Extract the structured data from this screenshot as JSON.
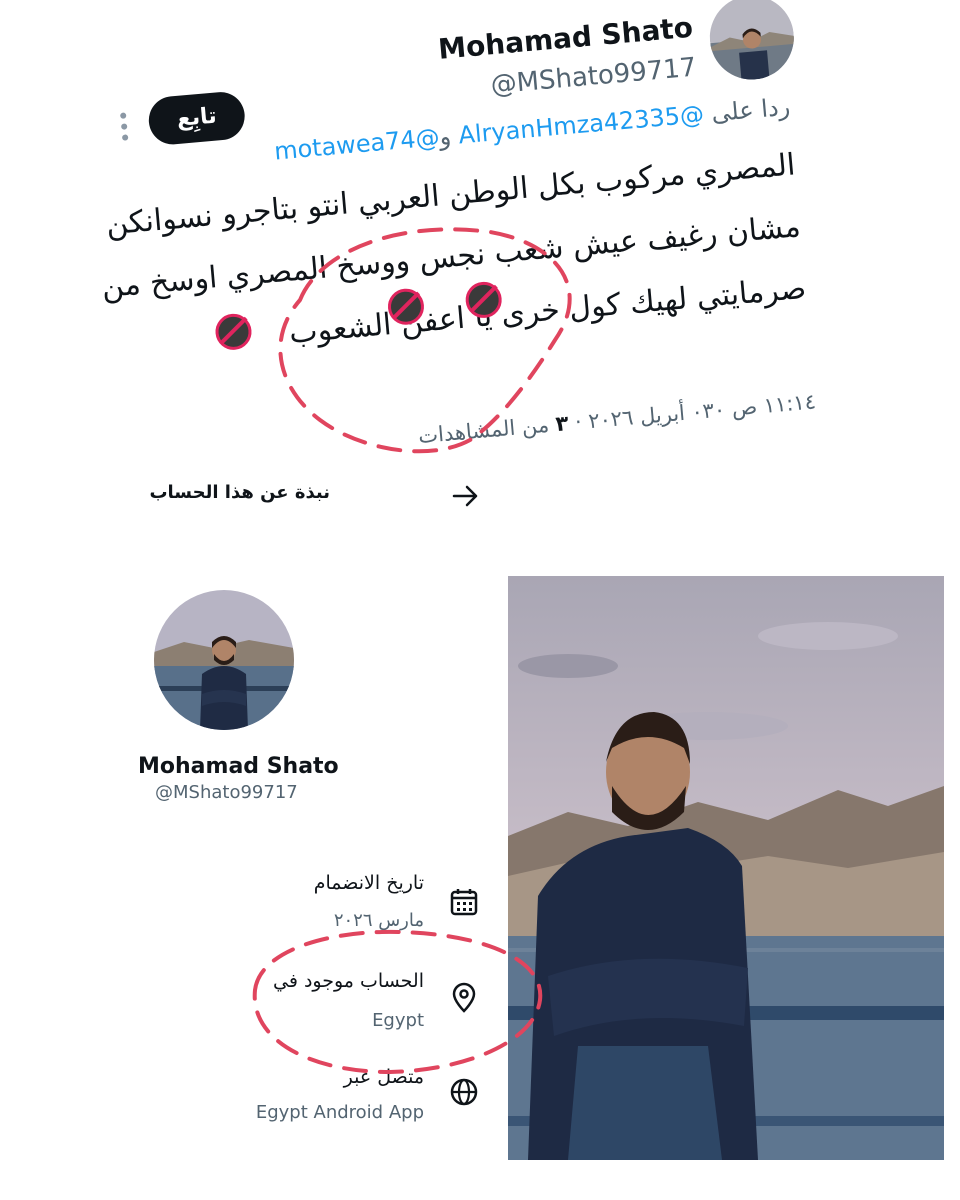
{
  "tweet": {
    "author_name": "Mohamad Shato",
    "author_handle": "@MShato99717",
    "follow_label": "تابِع",
    "more_icon": "more-vertical-icon",
    "reply_prefix": "ردا على",
    "reply_mention_1": "@AlryanHmza42335",
    "reply_connector": "و",
    "reply_mention_2": "@motawea74",
    "body_lines": [
      "المصري مركوب بكل الوطن العربي انتو بتاجرو نسوانكن",
      "مشان رغيف عيش شعب نجس ووسخ المصري اوسخ من",
      "صرمايتي لهيك كول خرى يا اعفن الشعوب"
    ],
    "time": "١١:١٤ ص ٠٣٠ أبريل ٢٠٢٦",
    "views_count": "٣",
    "views_label": "من المشاهدات"
  },
  "about": {
    "label": "نبذة عن هذا الحساب",
    "arrow_icon": "arrow-right-icon"
  },
  "profile": {
    "name": "Mohamad Shato",
    "handle": "@MShato99717",
    "info": [
      {
        "icon": "calendar-icon",
        "title": "تاريخ الانضمام",
        "value": "مارس ٢٠٢٦"
      },
      {
        "icon": "location-icon",
        "title": "الحساب موجود في",
        "value": "Egypt"
      },
      {
        "icon": "globe-icon",
        "title": "متصل عبر",
        "value": "Egypt Android App"
      }
    ]
  },
  "colors": {
    "link": "#1d9bf0",
    "text": "#0f1419",
    "muted": "#536471",
    "annotation": "#e0245e"
  }
}
